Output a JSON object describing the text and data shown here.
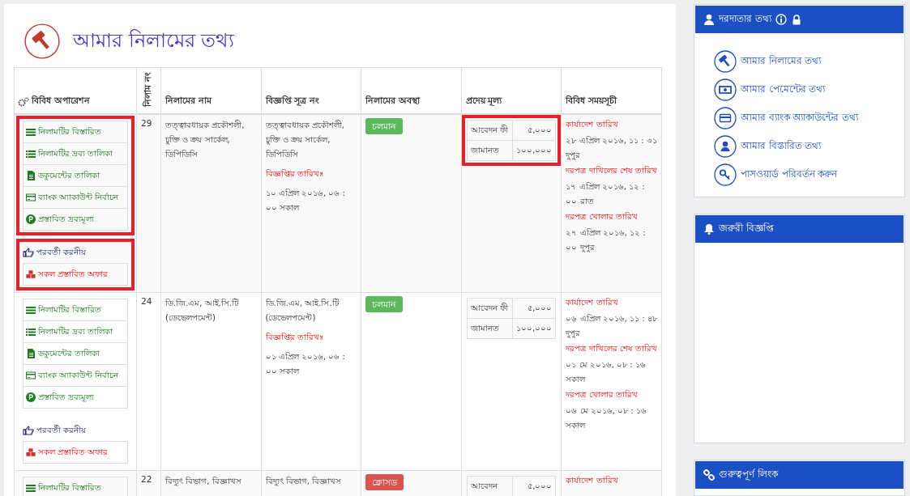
{
  "page_title": "আমার নিলামের তথ্য",
  "table": {
    "columns": [
      {
        "label": "বিবিধ অপারেশন",
        "kind": "ops"
      },
      {
        "label": "নিলাম নং",
        "kind": "vertical"
      },
      {
        "label": "নিলামের নাম",
        "kind": "plain"
      },
      {
        "label": "বিজ্ঞপ্তি সূত্র নং",
        "kind": "plain"
      },
      {
        "label": "নিলামের অবস্থা",
        "kind": "plain"
      },
      {
        "label": "প্রদেয় মূল্য",
        "kind": "plain"
      },
      {
        "label": "বিবিধ সময়সূচী",
        "kind": "plain"
      }
    ],
    "rows": [
      {
        "highlighted": true,
        "number": "29",
        "name": "তত্ত্বাবধায়ক প্রকৌশলী, চুক্তি ও ক্রয় সার্কেল, ডিপিডিসি",
        "ref": "তত্ত্বাবধায়ক প্রকৌশলী, চুক্তি ও ক্রয় সার্কেল, ডিপিডিসি",
        "notice_label": "বিজ্ঞপ্তির তারিখঃ",
        "notice_date": "১০ এপ্রিল ২০১৬, ০৬ : ০০ সকাল",
        "status": {
          "label": "চলমান",
          "kind": "running"
        },
        "operations": [
          {
            "label": "নিলামটির বিস্তারিত",
            "kind": "details"
          },
          {
            "label": "নিলামটির দ্রব্য তালিকা",
            "kind": "items"
          },
          {
            "label": "ডকুমেন্টের তালিকা",
            "kind": "docs"
          },
          {
            "label": "ব্যাংক অ্যাকাউন্ট নির্বাচন",
            "kind": "bank"
          },
          {
            "label": "প্রস্তাবিত দ্রব্যমূল্য",
            "kind": "price"
          }
        ],
        "next_label": "পরবর্তী করনীয়",
        "next_actions": [
          {
            "label": "সকল প্রস্তাবিত অফার"
          }
        ],
        "prices": [
          {
            "label": "আবেদন ফী",
            "value": "৫,০০০"
          },
          {
            "label": "জামানত",
            "value": "১০০,০০০"
          }
        ],
        "schedule": [
          {
            "label": "কার্যাদেশ তারিখ",
            "value": "২৮ এপ্রিল ২০১৬, ১১ : ৩১ দুপুর"
          },
          {
            "label": "দরপত্র দাখিলের শেষ তারিখ",
            "value": "১৭ এপ্রিল ২০১৬, ১২ : ০০ রাত"
          },
          {
            "label": "দরপত্র খোলার তারিখ",
            "value": "২৭ এপ্রিল ২০১৬, ১২ : ০০ দুপুর"
          }
        ]
      },
      {
        "highlighted": false,
        "number": "24",
        "name": "ডি.জি.এম, আই.সি.টি (ডেভেলপমেন্ট)",
        "ref": "ডি.জি.এম, আই.সি.টি (ডেভেলপমেন্ট)",
        "notice_label": "বিজ্ঞপ্তির তারিখঃ",
        "notice_date": "০১ এপ্রিল ২০১৬, ০৬ : ০০ সকাল",
        "status": {
          "label": "চলমান",
          "kind": "running"
        },
        "operations": [
          {
            "label": "নিলামটির বিস্তারিত",
            "kind": "details"
          },
          {
            "label": "নিলামটির দ্রব্য তালিকা",
            "kind": "items"
          },
          {
            "label": "ডকুমেন্টের তালিকা",
            "kind": "docs"
          },
          {
            "label": "ব্যাংক অ্যাকাউন্ট নির্বাচন",
            "kind": "bank"
          },
          {
            "label": "প্রস্তাবিত দ্রব্যমূল্য",
            "kind": "price"
          }
        ],
        "next_label": "পরবর্তী করনীয়",
        "next_actions": [
          {
            "label": "সকল প্রস্তাবিত অফার"
          }
        ],
        "prices": [
          {
            "label": "আবেদন ফী",
            "value": "৫,০০০"
          },
          {
            "label": "জামানত",
            "value": "১০০,০০০"
          }
        ],
        "schedule": [
          {
            "label": "কার্যাদেশ তারিখ",
            "value": "০৬ এপ্রিল ২০১৬, ১১ : ৪৮ দুপুর"
          },
          {
            "label": "দরপত্র দাখিলের শেষ তারিখ",
            "value": "০১ মে ২০১৬, ০৮ : ১৬ সকাল"
          },
          {
            "label": "দরপত্র খোলার তারিখ",
            "value": "০৬ মে ২০১৬, ০৮ : ১৬ সকাল"
          }
        ]
      },
      {
        "highlighted": false,
        "number": "22",
        "name": "বিদ্যুৎ বিভাগ, বিজ্ঞাখস",
        "ref": "বিদ্যুৎ বিভাগ, বিজ্ঞাখস",
        "status": {
          "label": "ক্লোসড",
          "kind": "closed"
        },
        "operations": [
          {
            "label": "নিলামটির বিস্তারিত",
            "kind": "details"
          }
        ],
        "prices": [
          {
            "label": "আবেদন",
            "value": "৫,০০০"
          }
        ],
        "schedule": [
          {
            "label": "কার্যাদেশ তারিখ"
          }
        ]
      }
    ]
  },
  "sidebar": [
    {
      "title": "দরদাতার তথ্য",
      "kind": "bidder",
      "links": [
        {
          "label": "আমার নিলামের তথ্য",
          "kind": "auctions"
        },
        {
          "label": "আমার পেমেন্টের তথ্য",
          "kind": "payments"
        },
        {
          "label": "আমার ব্যাংক অ্যাকাউন্টের তথ্য",
          "kind": "bank"
        },
        {
          "label": "আমার বিস্তারিত তথ্য",
          "kind": "profile"
        },
        {
          "label": "পাসওয়ার্ড পরিবর্তন করুন",
          "kind": "password"
        }
      ]
    },
    {
      "title": "জরুরী বিজ্ঞপ্তি",
      "kind": "notices"
    },
    {
      "title": "গুরুত্বপূর্ণ লিংক",
      "kind": "links"
    }
  ]
}
